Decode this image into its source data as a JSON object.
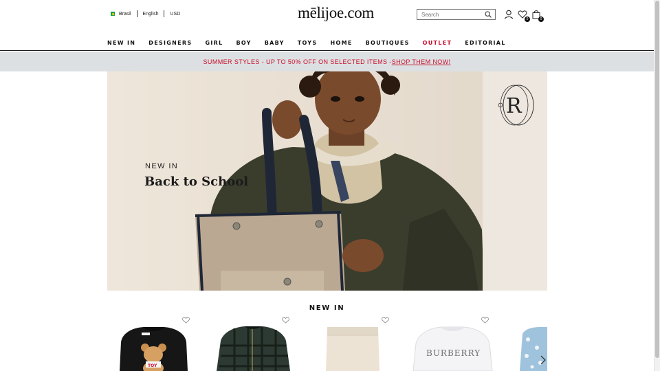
{
  "header": {
    "country": "Brasil",
    "language": "English",
    "currency": "USD",
    "logo_text": "mēlijoe.com",
    "search_placeholder": "Search",
    "wishlist_count": "0",
    "bag_count": "0"
  },
  "nav": {
    "items": [
      "NEW IN",
      "DESIGNERS",
      "GIRL",
      "BOY",
      "BABY",
      "TOYS",
      "HOME",
      "BOUTIQUES",
      "OUTLET",
      "EDITORIAL"
    ]
  },
  "promo": {
    "text": "SUMMER STYLES - UP TO 50% OFF ON SELECTED ITEMS - ",
    "link": "SHOP THEM NOW!"
  },
  "hero": {
    "kicker": "NEW IN",
    "title": "Back to School",
    "monogram": "R"
  },
  "new_in": {
    "title": "NEW IN",
    "products": [
      {
        "image": "black teddy bear sweatshirt",
        "badge_text": "TOY"
      },
      {
        "image": "plaid quilted jacket"
      },
      {
        "image": "beige knit shorts"
      },
      {
        "image": "white logo sweatshirt",
        "brand_text": "BURBERRY"
      },
      {
        "image": "blue printed dress"
      }
    ]
  },
  "colors": {
    "accent_red": "#c8102e",
    "promo_bg": "#dde0e2",
    "text": "#111111"
  },
  "icons": [
    "flag-icon",
    "search-icon",
    "user-icon",
    "wishlist-icon",
    "bag-icon",
    "heart-icon",
    "chevron-right-icon"
  ]
}
